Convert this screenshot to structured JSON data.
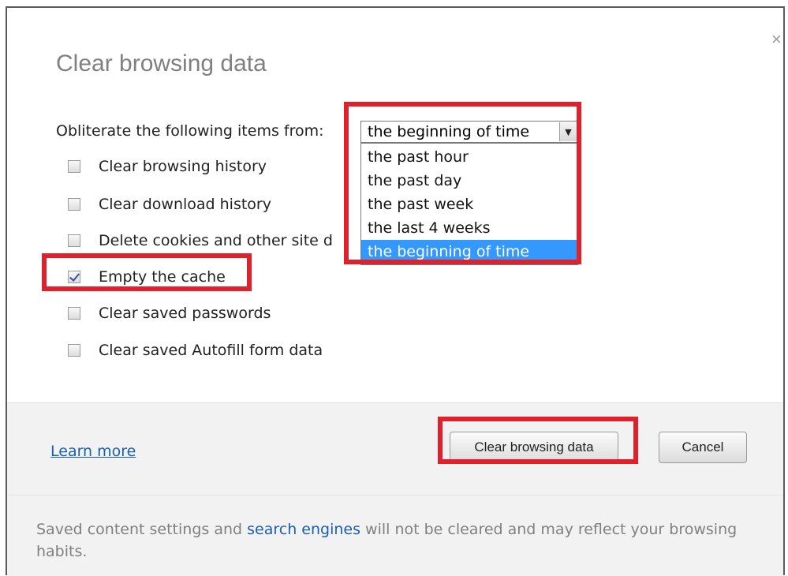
{
  "dialog": {
    "title": "Clear browsing data",
    "close_glyph": "×",
    "time_range": {
      "prompt": "Obliterate the following items from:",
      "selected": "the beginning of time",
      "options": [
        "the past hour",
        "the past day",
        "the past week",
        "the last 4 weeks",
        "the beginning of time"
      ],
      "arrow_icon": "dropdown-arrow-icon"
    },
    "checkboxes": [
      {
        "label": "Clear browsing history",
        "checked": false
      },
      {
        "label": "Clear download history",
        "checked": false
      },
      {
        "label": "Delete cookies and other site d",
        "checked": false
      },
      {
        "label": "Empty the cache",
        "checked": true
      },
      {
        "label": "Clear saved passwords",
        "checked": false
      },
      {
        "label": "Clear saved Autofill form data",
        "checked": false
      }
    ],
    "footer": {
      "learn_more": "Learn more",
      "clear_button": "Clear browsing data",
      "cancel_button": "Cancel",
      "note_before": "Saved content settings and ",
      "note_link": "search engines",
      "note_after": " will not be cleared and may reflect your browsing habits."
    }
  },
  "colors": {
    "highlight_border": "#e0202a",
    "selected_option_bg": "#3399ff",
    "link": "#1a5fb0"
  }
}
